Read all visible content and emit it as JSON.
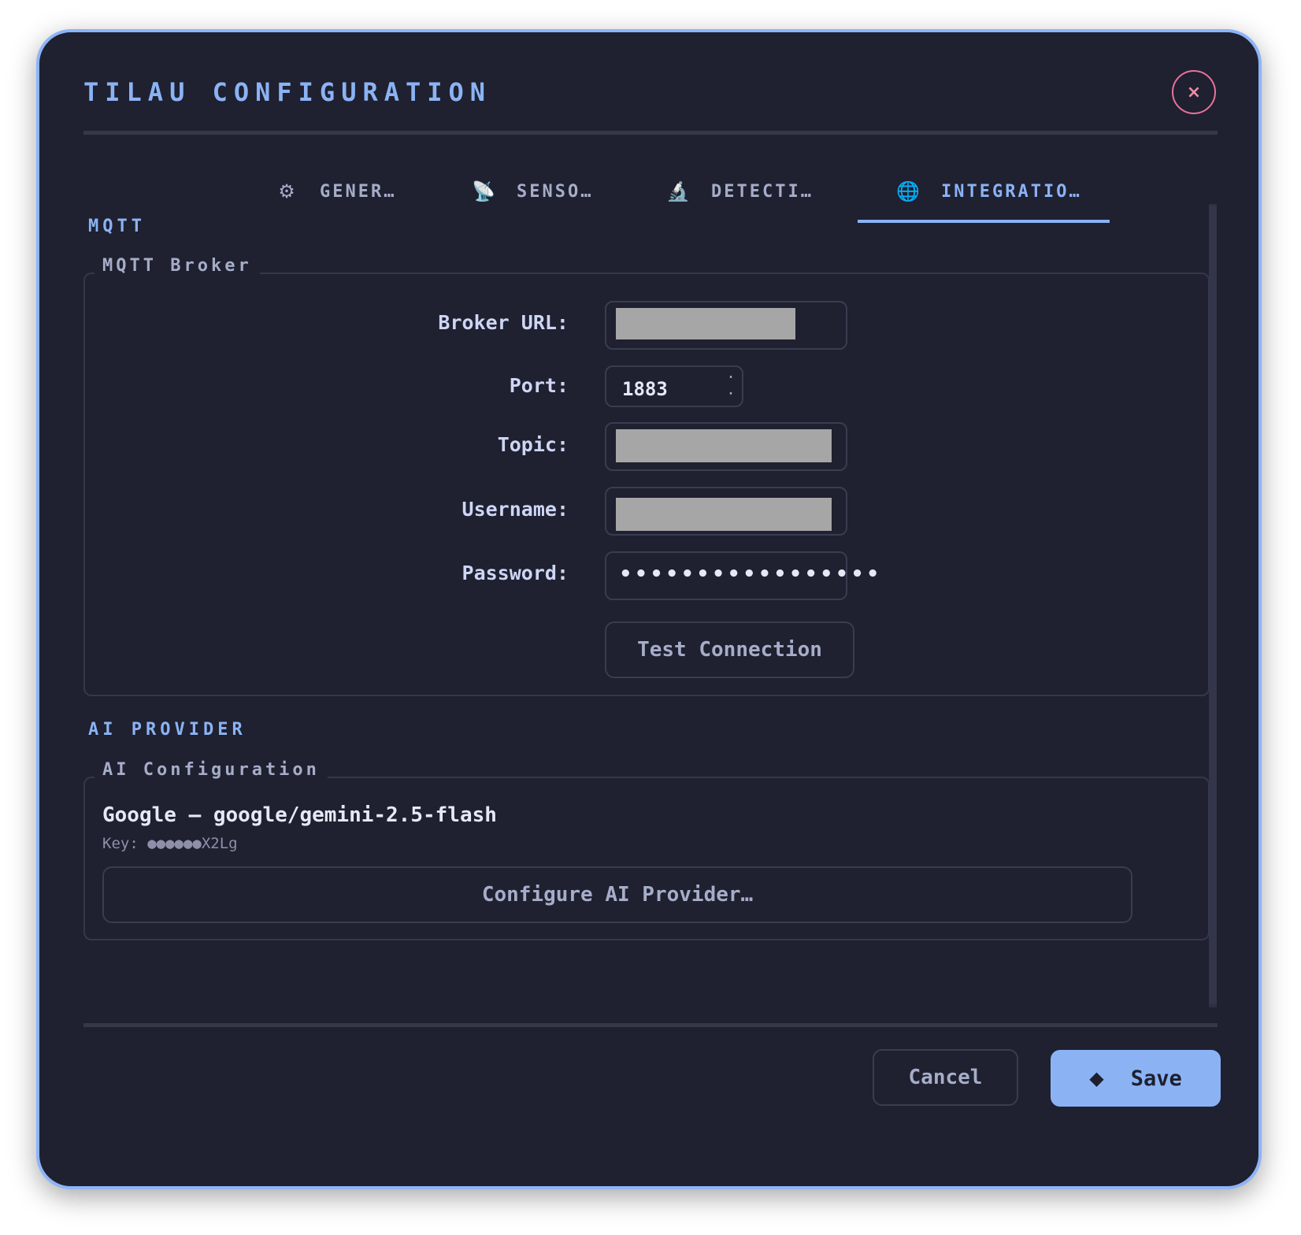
{
  "dialog": {
    "title": "TILAU CONFIGURATION",
    "close_label": "×"
  },
  "tabs": [
    {
      "icon": "⚙",
      "icon_name": "gear-icon",
      "label": "GENER…",
      "active": false
    },
    {
      "icon": "📡",
      "icon_name": "satellite-dish-icon",
      "label": "SENSO…",
      "active": false
    },
    {
      "icon": "🔬",
      "icon_name": "microscope-icon",
      "label": "DETECTI…",
      "active": false
    },
    {
      "icon": "🌐",
      "icon_name": "globe-icon",
      "label": "INTEGRATIO…",
      "active": true
    }
  ],
  "mqtt": {
    "section_title": "MQTT",
    "group_title": "MQTT Broker",
    "broker_url_label": "Broker URL:",
    "port_label": "Port:",
    "port_value": "1883",
    "topic_label": "Topic:",
    "username_label": "Username:",
    "password_label": "Password:",
    "password_mask": "•••••••••••••••••",
    "test_button": "Test Connection"
  },
  "ai": {
    "section_title": "AI PROVIDER",
    "group_title": "AI Configuration",
    "provider_line": "Google — google/gemini-2.5-flash",
    "key_line": "Key: ●●●●●●X2Lg",
    "configure_button": "Configure AI Provider…"
  },
  "footer": {
    "cancel_label": "Cancel",
    "save_icon": "◆",
    "save_label": "Save"
  },
  "colors": {
    "background": "#1f2030",
    "accent": "#8bb3f4",
    "close_accent": "#f38ba8",
    "text": "#cdd6f4",
    "muted_text": "#a6adc8"
  }
}
